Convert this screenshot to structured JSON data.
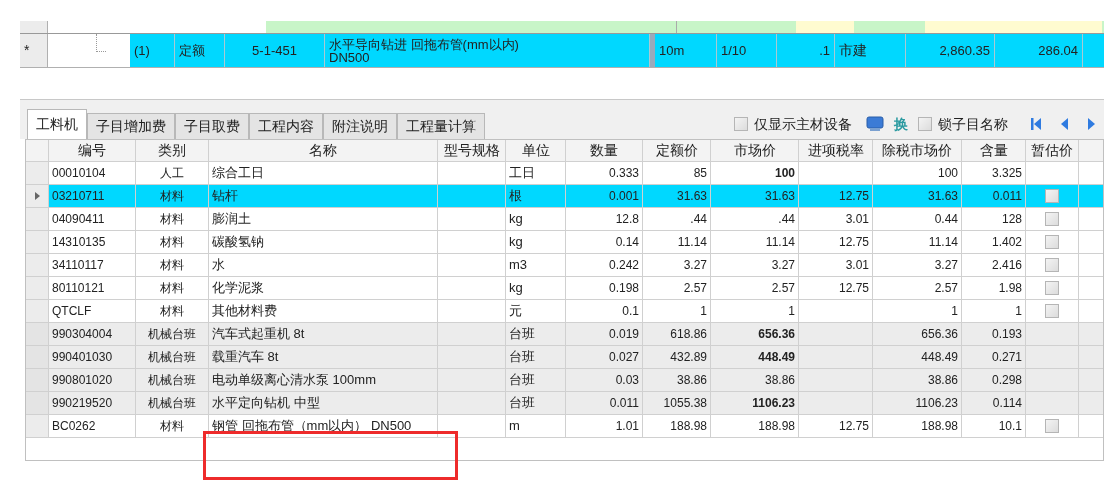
{
  "quota_row": {
    "marker": "*",
    "index": "(1)",
    "type": "定额",
    "code": "5-1-451",
    "name_lines": [
      "水平导向钻进 回拖布管(mm以内)",
      "DN500"
    ],
    "unit": "10m",
    "ratio": "1/10",
    "quantity": ".1",
    "specialty": "市建",
    "price": "2,860.35",
    "total": "286.04",
    "selected": true
  },
  "tabs": [
    {
      "label": "工料机",
      "selected": true
    },
    {
      "label": "子目增加费",
      "selected": false
    },
    {
      "label": "子目取费",
      "selected": false
    },
    {
      "label": "工程内容",
      "selected": false
    },
    {
      "label": "附注说明",
      "selected": false
    },
    {
      "label": "工程量计算",
      "selected": false
    }
  ],
  "toolbar": {
    "main_only": {
      "label": "仅显示主材设备",
      "checked": false
    },
    "swap": "换",
    "lock_name": {
      "label": "锁子目名称",
      "checked": false
    }
  },
  "table": {
    "columns": [
      "编号",
      "类别",
      "名称",
      "型号规格",
      "单位",
      "数量",
      "定额价",
      "市场价",
      "进项税率",
      "除税市场价",
      "含量",
      "暂估价"
    ],
    "rows": [
      {
        "kind": "labor",
        "selected": false,
        "code": "00010104",
        "category": "人工",
        "name": "综合工日",
        "unit": "工日",
        "qty": "0.333",
        "quota_price": "85",
        "market_price": "100",
        "market_bold": true,
        "net_price": "100",
        "content": "3.325"
      },
      {
        "kind": "material",
        "selected": true,
        "code": "03210711",
        "category": "材料",
        "name": "钻杆",
        "unit": "根",
        "qty": "0.001",
        "quota_price": "31.63",
        "market_price": "31.63",
        "market_bold": false,
        "tax_rate": "12.75",
        "net_price": "31.63",
        "content": "0.011",
        "estimate": {
          "checked": false
        }
      },
      {
        "kind": "material",
        "selected": false,
        "code": "04090411",
        "category": "材料",
        "name": "膨润土",
        "unit": "kg",
        "qty": "12.8",
        "quota_price": ".44",
        "market_price": ".44",
        "market_bold": false,
        "tax_rate": "3.01",
        "net_price": "0.44",
        "content": "128",
        "estimate": {
          "checked": false
        }
      },
      {
        "kind": "material",
        "selected": false,
        "code": "14310135",
        "category": "材料",
        "name": "碳酸氢钠",
        "unit": "kg",
        "qty": "0.14",
        "quota_price": "11.14",
        "market_price": "11.14",
        "market_bold": false,
        "tax_rate": "12.75",
        "net_price": "11.14",
        "content": "1.402",
        "estimate": {
          "checked": false
        }
      },
      {
        "kind": "material",
        "selected": false,
        "code": "34110117",
        "category": "材料",
        "name": "水",
        "unit": "m3",
        "qty": "0.242",
        "quota_price": "3.27",
        "market_price": "3.27",
        "market_bold": false,
        "tax_rate": "3.01",
        "net_price": "3.27",
        "content": "2.416",
        "estimate": {
          "checked": false
        }
      },
      {
        "kind": "material",
        "selected": false,
        "code": "80110121",
        "category": "材料",
        "name": "化学泥浆",
        "unit": "kg",
        "qty": "0.198",
        "quota_price": "2.57",
        "market_price": "2.57",
        "market_bold": false,
        "tax_rate": "12.75",
        "net_price": "2.57",
        "content": "1.98",
        "estimate": {
          "checked": false
        }
      },
      {
        "kind": "material",
        "selected": false,
        "code": "QTCLF",
        "category": "材料",
        "name": "其他材料费",
        "unit": "元",
        "qty": "0.1",
        "quota_price": "1",
        "market_price": "1",
        "market_bold": false,
        "net_price": "1",
        "content": "1",
        "estimate": {
          "checked": false
        }
      },
      {
        "kind": "machine",
        "selected": false,
        "code": "990304004",
        "category": "机械台班",
        "name": "汽车式起重机 8t",
        "unit": "台班",
        "qty": "0.019",
        "quota_price": "618.86",
        "market_price": "656.36",
        "market_bold": true,
        "net_price": "656.36",
        "content": "0.193"
      },
      {
        "kind": "machine",
        "selected": false,
        "code": "990401030",
        "category": "机械台班",
        "name": "载重汽车 8t",
        "unit": "台班",
        "qty": "0.027",
        "quota_price": "432.89",
        "market_price": "448.49",
        "market_bold": true,
        "net_price": "448.49",
        "content": "0.271"
      },
      {
        "kind": "machine",
        "selected": false,
        "code": "990801020",
        "category": "机械台班",
        "name": "电动单级离心清水泵 100mm",
        "unit": "台班",
        "qty": "0.03",
        "quota_price": "38.86",
        "market_price": "38.86",
        "market_bold": false,
        "net_price": "38.86",
        "content": "0.298"
      },
      {
        "kind": "machine",
        "selected": false,
        "code": "990219520",
        "category": "机械台班",
        "name": "水平定向钻机 中型",
        "unit": "台班",
        "qty": "0.011",
        "quota_price": "1055.38",
        "market_price": "1106.23",
        "market_bold": true,
        "net_price": "1106.23",
        "content": "0.114"
      },
      {
        "kind": "material",
        "selected": false,
        "code": "BC0262",
        "category": "材料",
        "name": "钢管 回拖布管（mm以内） DN500",
        "unit": "m",
        "qty": "1.01",
        "quota_price": "188.98",
        "market_price": "188.98",
        "market_bold": false,
        "tax_rate": "12.75",
        "net_price": "188.98",
        "content": "10.1",
        "estimate": {
          "checked": false
        }
      }
    ]
  }
}
